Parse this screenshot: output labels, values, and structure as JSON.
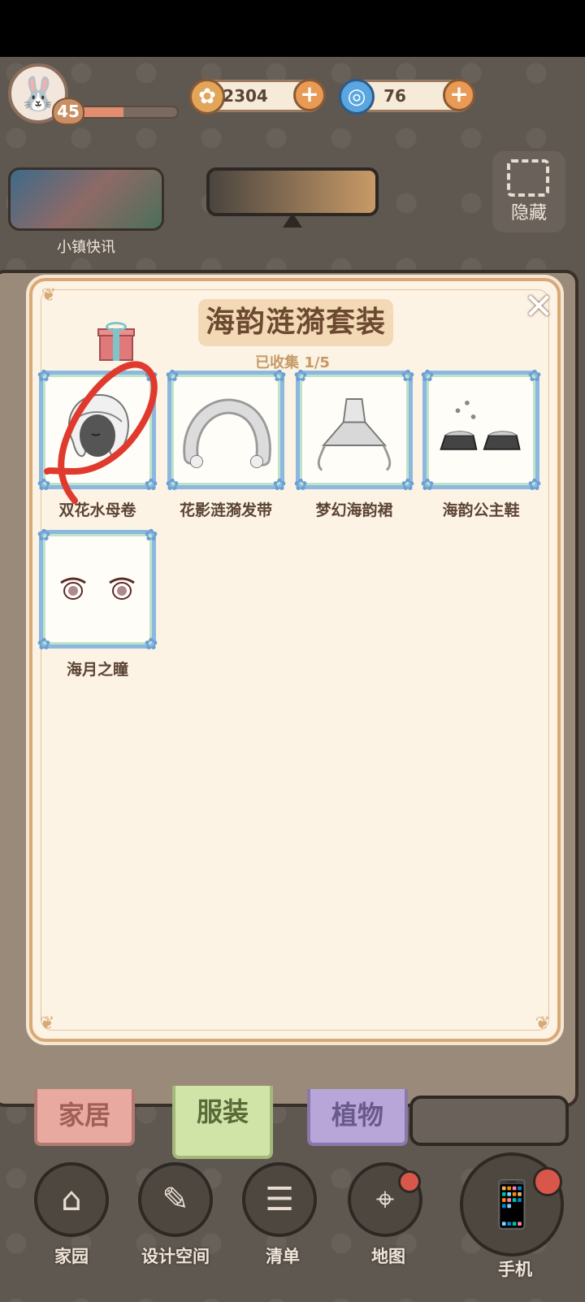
{
  "hud": {
    "level": "45",
    "xp_fraction": 0.45,
    "coins": "2304",
    "gems": "76",
    "news_label": "小镇快讯",
    "hide_label": "隐藏"
  },
  "dialog": {
    "title": "海韵涟漪套装",
    "progress": "已收集 1/5",
    "items": [
      {
        "label": "双花水母卷",
        "icon": "hair-icon",
        "collected": true
      },
      {
        "label": "花影涟漪发带",
        "icon": "headband-icon",
        "collected": false
      },
      {
        "label": "梦幻海韵裙",
        "icon": "dress-icon",
        "collected": false
      },
      {
        "label": "海韵公主鞋",
        "icon": "shoes-icon",
        "collected": false
      },
      {
        "label": "海月之瞳",
        "icon": "eyes-icon",
        "collected": true
      }
    ]
  },
  "tabs": {
    "home": "家居",
    "clothes": "服装",
    "plants": "植物"
  },
  "nav": {
    "garden": "家园",
    "design": "设计空间",
    "list": "清单",
    "map": "地图",
    "phone": "手机"
  },
  "colors": {
    "dialog_bg": "#fcf3e5",
    "card_border": "#8cb8e0",
    "annotation_red": "#e03a2e"
  }
}
